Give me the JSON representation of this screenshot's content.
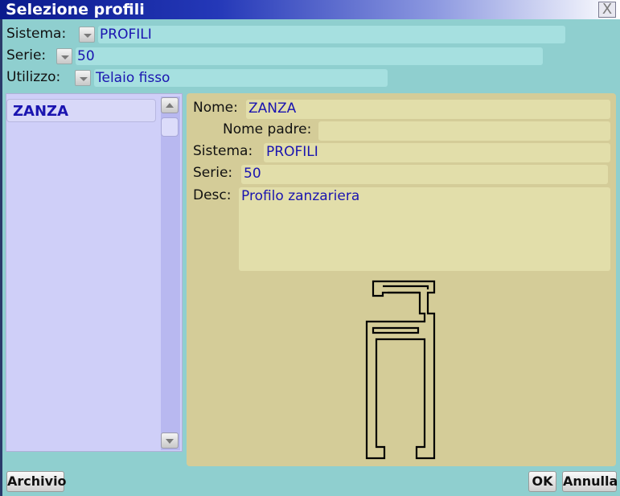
{
  "window": {
    "title": "Selezione profili",
    "close_glyph": "X"
  },
  "filters": {
    "sistema": {
      "label": "Sistema:",
      "value": "PROFILI"
    },
    "serie": {
      "label": "Serie:",
      "value": "50"
    },
    "utilizzo": {
      "label": "Utilizzo:",
      "value": "Telaio fisso"
    }
  },
  "profile_list": {
    "items": [
      "ZANZA"
    ]
  },
  "details": {
    "nome": {
      "label": "Nome:",
      "value": "ZANZA"
    },
    "nome_padre": {
      "label": "Nome padre:",
      "value": ""
    },
    "sistema": {
      "label": "Sistema:",
      "value": "PROFILI"
    },
    "serie": {
      "label": "Serie:",
      "value": "50"
    },
    "desc": {
      "label": "Desc:",
      "value": "Profilo zanzariera"
    }
  },
  "buttons": {
    "archivio": "Archivio",
    "ok": "OK",
    "annulla": "Annulla"
  },
  "icons": {
    "close": "close-icon",
    "dropdown": "chevron-down-icon",
    "scroll_up": "arrow-up-icon",
    "scroll_down": "arrow-down-icon",
    "profile_drawing": "profile-section-drawing"
  }
}
